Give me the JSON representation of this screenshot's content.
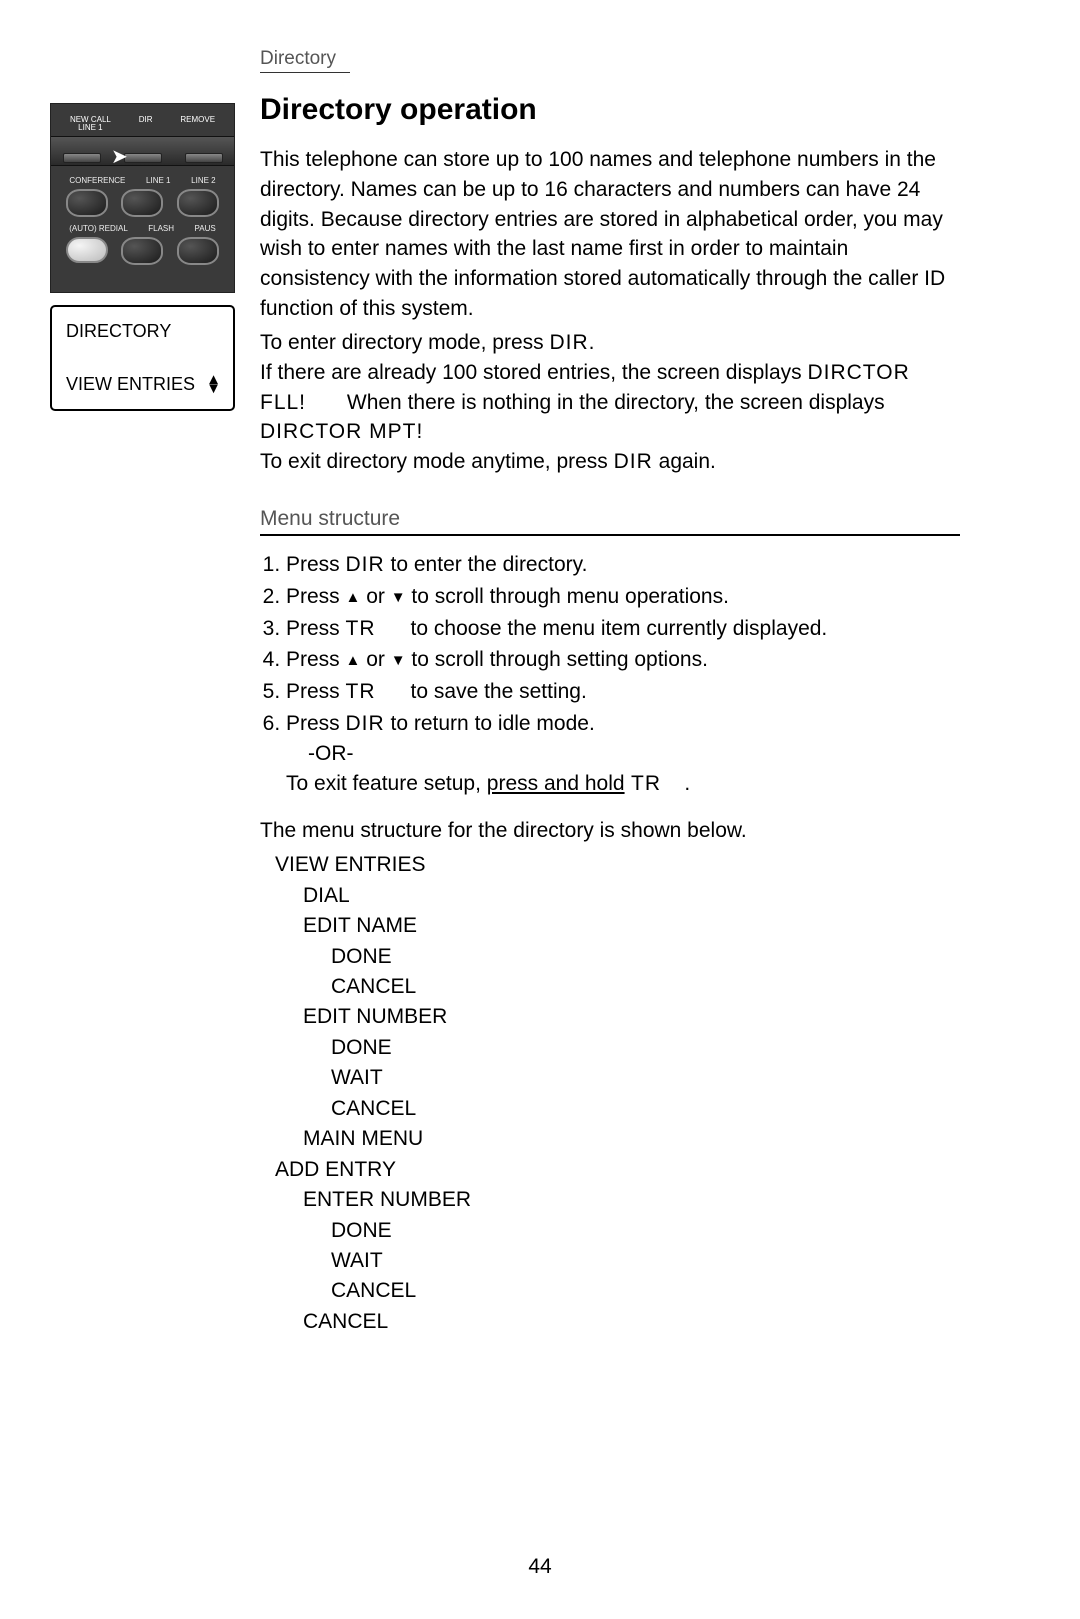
{
  "header": {
    "section_label": "Directory"
  },
  "title": "Directory operation",
  "intro": "This telephone can store up to 100 names and telephone numbers in the directory. Names can be up to 16 characters and numbers can have 24 digits. Because directory entries are stored in alphabetical order, you may wish to enter names with the last name first in order to maintain consistency with the information stored automatically through the caller ID function of this system.",
  "enter_text_pre": "To enter directory mode, press ",
  "key_dir": "DIR",
  "enter_text_post": ".",
  "full_text_pre": "If there are already 100 stored entries, the screen displays ",
  "full_code": "DIRCTOR FLL!",
  "full_text_mid": " When there is nothing in the directory, the screen displays ",
  "empty_code": "DIRCTOR MPT!",
  "exit_text_pre": "To exit directory mode anytime, press ",
  "exit_text_post": " again.",
  "menu_heading": "Menu structure",
  "steps": {
    "s1_pre": "Press ",
    "s1_key": "DIR",
    "s1_post": " to enter the directory.",
    "s2_pre": "Press ",
    "s2_mid": " or ",
    "s2_post": " to scroll through menu operations.",
    "s3_pre": "Press ",
    "s3_key": "TR",
    "s3_post": " to choose the menu item currently displayed.",
    "s4_pre": "Press ",
    "s4_mid": " or ",
    "s4_post": " to scroll through setting options.",
    "s5_pre": "Press ",
    "s5_key": "TR",
    "s5_post": " to save the setting.",
    "s6_pre": "Press ",
    "s6_key": "DIR",
    "s6_post": " to return to idle mode.",
    "or": "-OR-",
    "s6b_pre": "To exit feature setup, ",
    "s6b_u": "press and hold",
    "s6b_key": " TR",
    "s6b_post": "."
  },
  "tree_intro": "The menu structure for the directory is shown below.",
  "tree": {
    "view_entries": "VIEW ENTRIES",
    "dial": "DIAL",
    "edit_name": "EDIT NAME",
    "done": "DONE",
    "cancel": "CANCEL",
    "edit_number": "EDIT NUMBER",
    "wait": "WAIT",
    "main_menu": "MAIN MENU",
    "add_entry": "ADD ENTRY",
    "enter_number": "ENTER NUMBER"
  },
  "lcd": {
    "line1": "DIRECTORY",
    "line2": "VIEW ENTRIES"
  },
  "phone": {
    "new_call": "NEW CALL\nLINE 1",
    "dir": "DIR",
    "remove": "REMOVE",
    "conference": "CONFERENCE",
    "line1": "LINE 1",
    "line2": "LINE 2",
    "auto_redial": "(AUTO) REDIAL",
    "flash": "FLASH",
    "pause": "PAUS"
  },
  "page_number": "44"
}
